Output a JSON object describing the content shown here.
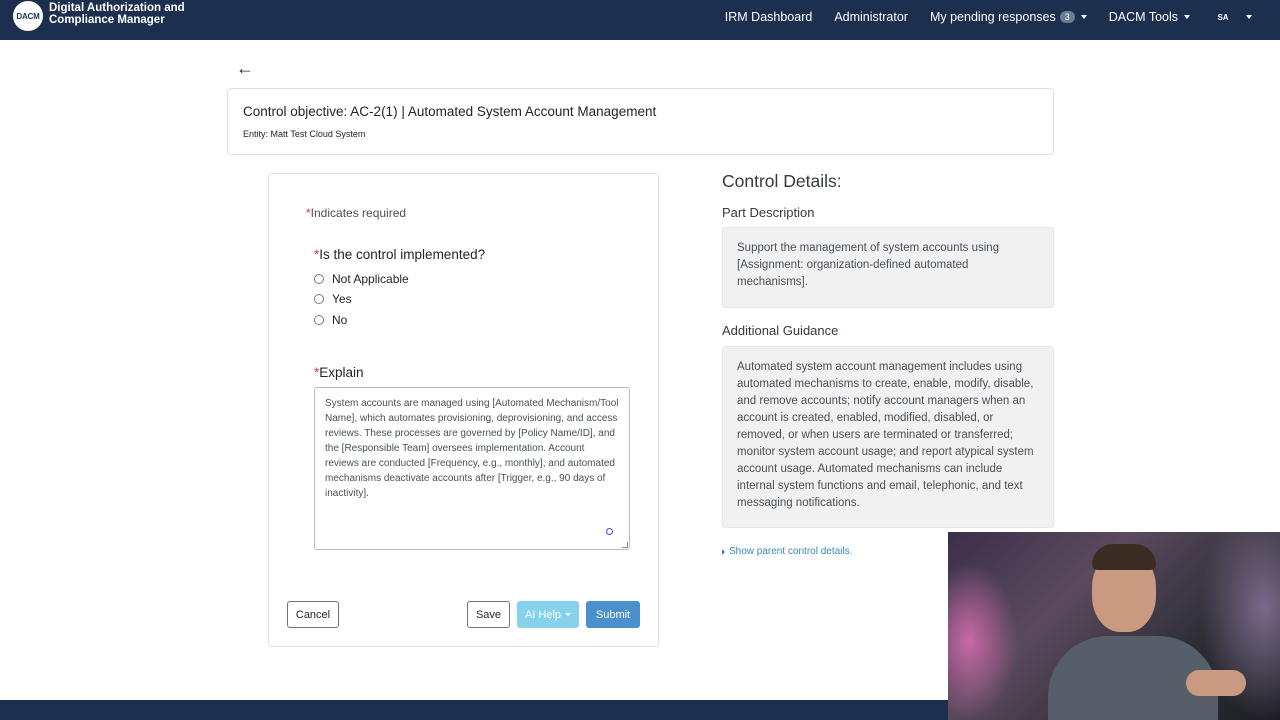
{
  "header": {
    "logo_text": "DACM",
    "brand_line1": "Digital Authorization and",
    "brand_line2": "Compliance Manager",
    "nav": {
      "irm_dashboard": "IRM Dashboard",
      "administrator": "Administrator",
      "pending_responses": "My pending responses",
      "pending_count": "3",
      "dacm_tools": "DACM Tools",
      "user_initials": "SA"
    }
  },
  "back": {
    "icon": "arrow-left-icon",
    "glyph": "←"
  },
  "objective": {
    "title": "Control objective: AC-2(1) | Automated System Account Management",
    "entity": "Entity: Matt Test Cloud System"
  },
  "form": {
    "required_marker": "*",
    "indicates_required": "Indicates required",
    "question": "Is the control implemented?",
    "options": [
      "Not Applicable",
      "Yes",
      "No"
    ],
    "explain_label": "Explain",
    "explain_value": "System accounts are managed using [Automated Mechanism/Tool Name], which automates provisioning, deprovisioning, and access reviews. These processes are governed by [Policy Name/ID], and the [Responsible Team] oversees implementation. Account reviews are conducted [Frequency, e.g., monthly], and automated mechanisms deactivate accounts after [Trigger, e.g., 90 days of inactivity].",
    "buttons": {
      "cancel": "Cancel",
      "save": "Save",
      "ai_help": "AI Help",
      "submit": "Submit"
    },
    "colors": {
      "ai_help": "#86d1ec",
      "submit": "#4a90cc",
      "required": "#dc3545"
    }
  },
  "details": {
    "heading": "Control Details:",
    "part_description_label": "Part Description",
    "part_description": "Support the management of system accounts using [Assignment: organization-defined automated mechanisms].",
    "additional_guidance_label": "Additional Guidance",
    "additional_guidance": "Automated system account management includes using automated mechanisms to create, enable, modify, disable, and remove accounts; notify account managers when an account is created, enabled, modified, disabled, or removed, or when users are terminated or transferred; monitor system account usage; and report atypical system account usage. Automated mechanisms can include internal system functions and email, telephonic, and text messaging notifications.",
    "show_parent": "Show parent control details."
  },
  "theme": {
    "nav_bg": "#1d2f4f",
    "link": "#3a87b5"
  }
}
